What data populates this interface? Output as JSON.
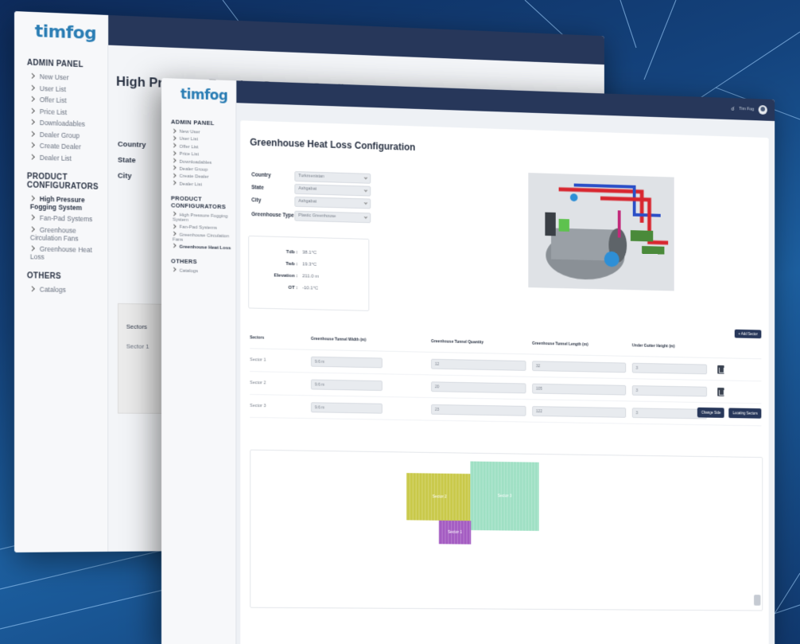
{
  "brand": "timfog",
  "back_window": {
    "title": "High Pressure Fogging System Configurator",
    "admin_title": "ADMIN PANEL",
    "admin_items": [
      "New User",
      "User List",
      "Offer List",
      "Price List",
      "Downloadables",
      "Dealer Group",
      "Create Dealer",
      "Dealer List"
    ],
    "product_title": "PRODUCT CONFIGURATORS",
    "product_items": [
      "High Pressure Fogging System",
      "Fan-Pad Systems",
      "Greenhouse Circulation Fans",
      "Greenhouse Heat Loss"
    ],
    "others_title": "OTHERS",
    "others_items": [
      "Catalogs"
    ],
    "fields": [
      "Country",
      "State",
      "City"
    ],
    "sectors_header": "Sectors",
    "sector_row": "Sector 1"
  },
  "front_window": {
    "admin_title": "ADMIN PANEL",
    "admin_items": [
      "New User",
      "User List",
      "Offer List",
      "Price List",
      "Downloadables",
      "Dealer Group",
      "Create Dealer",
      "Dealer List"
    ],
    "product_title": "PRODUCT CONFIGURATORS",
    "product_items": [
      "High Pressure Fogging System",
      "Fan-Pad Systems",
      "Greenhouse Circulation Fans",
      "Greenhouse Heat Loss"
    ],
    "others_title": "OTHERS",
    "others_items": [
      "Catalogs"
    ],
    "topbar": {
      "user": "Tim Fog"
    },
    "page_title": "Greenhouse Heat Loss Configuration",
    "form": {
      "country_label": "Country",
      "country_value": "Turkmenistan",
      "state_label": "State",
      "state_value": "Ashgabat",
      "city_label": "City",
      "city_value": "Ashgabat",
      "type_label": "Greenhouse Type",
      "type_value": "Plastic Greenhouse"
    },
    "climate": {
      "tdb_label": "Tdb :",
      "tdb_value": "38.1°C",
      "twb_label": "Twb :",
      "twb_value": "19.3°C",
      "elevation_label": "Elevation :",
      "elevation_value": "211.0 m",
      "ot_label": "OT :",
      "ot_value": "-10.1°C"
    },
    "table": {
      "add_button": "+ Add Sector",
      "headers": [
        "Sectors",
        "Greenhouse Tunnel Width (m)",
        "Greenhouse Tunnel Quantity",
        "Greenhouse Tunnel Length (m)",
        "Under Gutter Height (m)"
      ],
      "rows": [
        {
          "sector": "Sector 1",
          "width": "9.6 m",
          "quantity": "12",
          "length": "32",
          "height": "3"
        },
        {
          "sector": "Sector 2",
          "width": "9.6 m",
          "quantity": "20",
          "length": "105",
          "height": "3"
        },
        {
          "sector": "Sector 3",
          "width": "9.6 m",
          "quantity": "23",
          "length": "122",
          "height": "3"
        }
      ]
    },
    "actions": {
      "change_side": "Change Side",
      "locating_sectors": "Locating Sectors"
    },
    "layout": [
      {
        "label": "Sector 2",
        "color": "#c9c94a"
      },
      {
        "label": "Sector 3",
        "color": "#9fe0c4"
      },
      {
        "label": "Sector 1",
        "color": "#a45cc2"
      }
    ]
  },
  "colors": {
    "navy": "#27375a",
    "brand_blue": "#2a7db4"
  }
}
